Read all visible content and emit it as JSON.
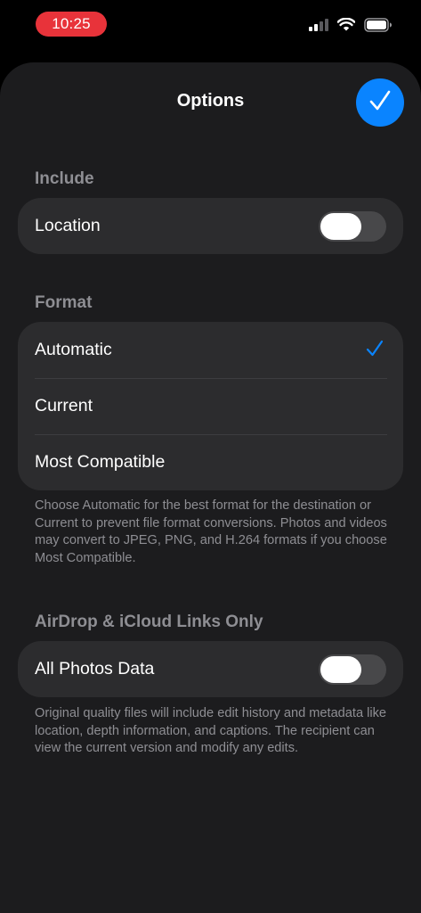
{
  "status_bar": {
    "time": "10:25",
    "icons": [
      "cellular-signal-icon",
      "wifi-icon",
      "battery-icon"
    ]
  },
  "sheet": {
    "title": "Options",
    "done_icon": "checkmark-icon"
  },
  "include": {
    "header": "Include",
    "rows": [
      {
        "label": "Location",
        "toggle_on": false
      }
    ]
  },
  "format": {
    "header": "Format",
    "options": [
      {
        "label": "Automatic",
        "selected": true
      },
      {
        "label": "Current",
        "selected": false
      },
      {
        "label": "Most Compatible",
        "selected": false
      }
    ],
    "note": "Choose Automatic for the best format for the destination or Current to prevent file format conversions. Photos and videos may convert to JPEG, PNG, and H.264 formats if you choose Most Compatible."
  },
  "airdrop": {
    "header": "AirDrop & iCloud Links Only",
    "rows": [
      {
        "label": "All Photos Data",
        "toggle_on": false
      }
    ],
    "note": "Original quality files will include edit history and metadata like location, depth information, and captions. The recipient can view the current version and modify any edits."
  },
  "colors": {
    "accent": "#0a84ff",
    "time_pill": "#e8333a",
    "sheet_background": "#1c1c1e",
    "group_background": "#2c2c2e",
    "secondary_text": "#8e8e93"
  }
}
